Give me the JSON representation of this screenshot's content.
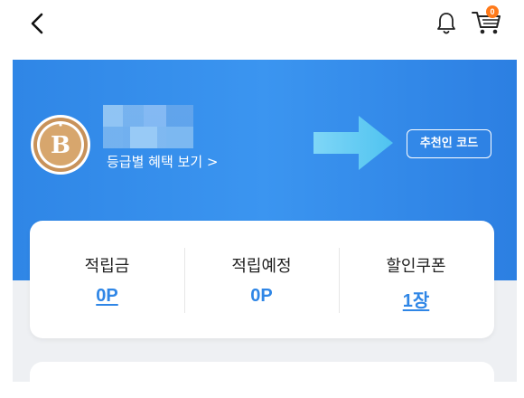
{
  "header": {
    "back_icon": "chevron-left-icon",
    "bell_icon": "bell-icon",
    "cart_icon": "cart-icon",
    "cart_badge": "0"
  },
  "profile": {
    "grade_letter": "B",
    "benefits_link": "등급별 혜택 보기 >",
    "referral_button": "추천인 코드"
  },
  "stats": [
    {
      "label": "적립금",
      "value": "0P"
    },
    {
      "label": "적립예정",
      "value": "0P"
    },
    {
      "label": "할인쿠폰",
      "value": "1장"
    }
  ],
  "colors": {
    "accent": "#2f86e6",
    "badge": "#ff7a1a",
    "grade_gold": "#c8925a"
  }
}
